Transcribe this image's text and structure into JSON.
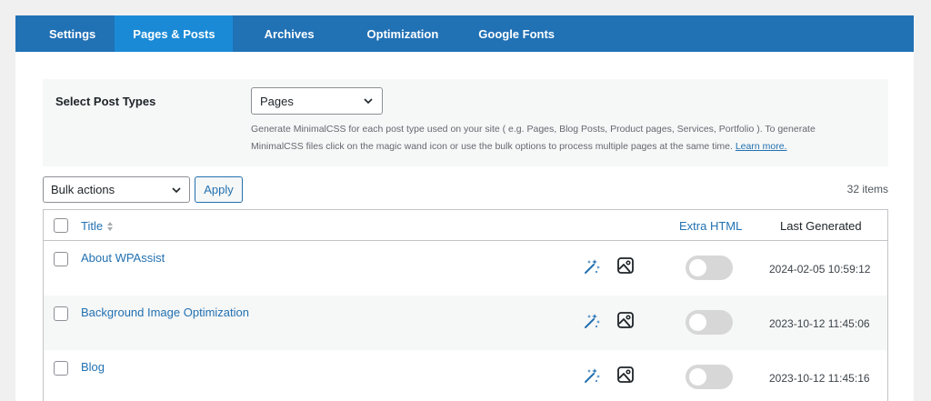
{
  "tabs": [
    {
      "label": "Settings",
      "active": false
    },
    {
      "label": "Pages & Posts",
      "active": true
    },
    {
      "label": "Archives",
      "active": false
    },
    {
      "label": "Optimization",
      "active": false
    },
    {
      "label": "Google Fonts",
      "active": false
    }
  ],
  "post_types": {
    "label": "Select Post Types",
    "selected": "Pages",
    "help_text": "Generate MinimalCSS for each post type used on your site ( e.g. Pages, Blog Posts, Product pages, Services, Portfolio ). To generate MinimalCSS files click on the magic wand icon or use the bulk options to process multiple pages at the same time.",
    "help_link": "Learn more."
  },
  "bulk": {
    "selected": "Bulk actions",
    "apply_label": "Apply",
    "item_count": "32 items"
  },
  "table": {
    "columns": {
      "title": "Title",
      "extra_html": "Extra HTML",
      "last_generated": "Last Generated"
    },
    "rows": [
      {
        "title": "About WPAssist",
        "last_generated": "2024-02-05 10:59:12",
        "extra_html": false
      },
      {
        "title": "Background Image Optimization",
        "last_generated": "2023-10-12 11:45:06",
        "extra_html": false
      },
      {
        "title": "Blog",
        "last_generated": "2023-10-12 11:45:16",
        "extra_html": false
      }
    ]
  },
  "colors": {
    "tab_bar": "#2171b5",
    "tab_active": "#1b8ad6",
    "link": "#2271b1"
  },
  "icons": {
    "wand": "magic-wand-icon",
    "image": "image-icon",
    "sort": "sort-arrows-icon",
    "chevron": "chevron-down-icon"
  }
}
